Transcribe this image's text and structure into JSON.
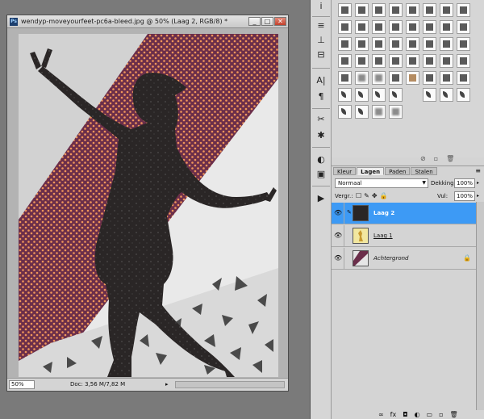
{
  "document": {
    "title": "wendyp-moveyourfeet-pc6a-bleed.jpg @ 50% (Laag 2, RGB/8) *",
    "app_icon_label": "Ps",
    "window_buttons": [
      "_",
      "□",
      "✕"
    ],
    "zoom": "50%",
    "doc_info": "Doc: 3,56 M/7,82 M",
    "status_arrow": "▸"
  },
  "tools": [
    "i",
    "≡",
    "⊥",
    "⊟",
    "A|",
    "¶",
    "✂",
    "✱",
    "◐",
    "▣",
    "▶"
  ],
  "swatches": {
    "rows": [
      [
        "s",
        "s",
        "s",
        "s",
        "s",
        "s",
        "s",
        "s"
      ],
      [
        "s",
        "s",
        "s",
        "s",
        "s",
        "s",
        "s",
        "s"
      ],
      [
        "s",
        "s",
        "s",
        "s",
        "s",
        "s",
        "s",
        "s"
      ],
      [
        "s",
        "s",
        "s",
        "s",
        "s",
        "s",
        "s",
        "s"
      ],
      [
        "s",
        "blur",
        "blur",
        "s",
        "tan",
        "s",
        "s",
        "s"
      ],
      [
        "leaf",
        "leaf",
        "leaf",
        "leaf",
        "empty",
        "leaf",
        "leaf",
        "leaf"
      ],
      [
        "leaf",
        "leaf",
        "blur",
        "blur",
        "empty",
        "empty",
        "empty",
        "empty"
      ]
    ],
    "footer_icons": [
      "⊘",
      "▫",
      "🗑"
    ]
  },
  "layers_panel": {
    "tabs": [
      "Kleur",
      "Lagen",
      "Paden",
      "Stalen"
    ],
    "active_tab": "Lagen",
    "menu_icon": "≡",
    "blend_mode": "Normaal",
    "opacity_label": "Dekking:",
    "opacity_value": "100%",
    "lock_label": "Vergr.:",
    "lock_icons": [
      "☐",
      "✎",
      "✥",
      "🔒"
    ],
    "fill_label": "Vul:",
    "fill_value": "100%",
    "layers": [
      {
        "name": "Laag 2",
        "selected": true,
        "locked": false
      },
      {
        "name": "Laag 1",
        "selected": false,
        "locked": false
      },
      {
        "name": "Achtergrond",
        "selected": false,
        "locked": true
      }
    ],
    "footer_icons": [
      "∞",
      "fx",
      "◘",
      "◐",
      "▭",
      "▫",
      "🗑"
    ]
  },
  "colors": {
    "maroon": "#6b2e4a",
    "dot": "#f0965a",
    "silhouette": "#2a2626",
    "selected_layer": "#3d9af5"
  }
}
